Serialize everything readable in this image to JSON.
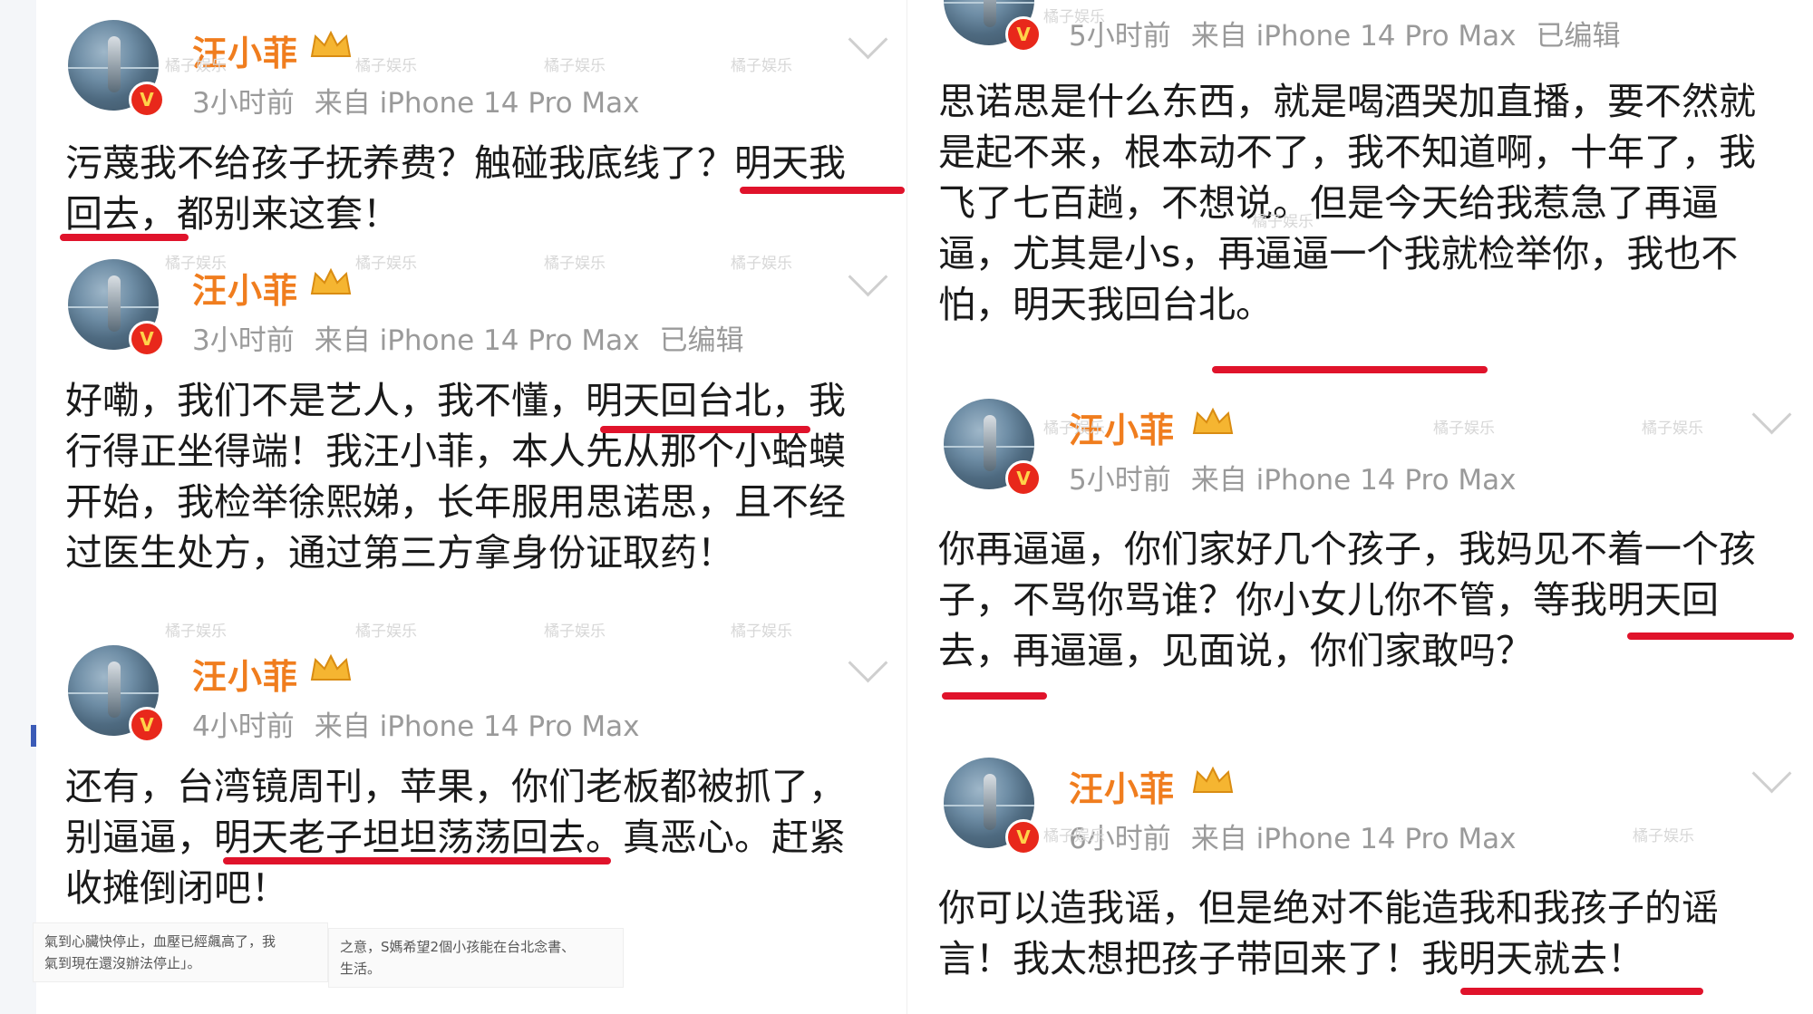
{
  "watermark": "橘子娱乐",
  "left": {
    "posts": [
      {
        "name": "汪小菲",
        "time": "3小时前",
        "source": "来自 iPhone 14 Pro Max",
        "edited": "",
        "text": "污蔑我不给孩子抚养费？触碰我底线了？明天我回去，都别来这套！"
      },
      {
        "name": "汪小菲",
        "time": "3小时前",
        "source": "来自 iPhone 14 Pro Max",
        "edited": "已编辑",
        "text": "好嘞，我们不是艺人，我不懂，明天回台北，我行得正坐得端！我汪小菲，本人先从那个小蛤蟆开始，我检举徐熙娣，长年服用思诺思，且不经过医生处方，通过第三方拿身份证取药！"
      },
      {
        "name": "汪小菲",
        "time": "4小时前",
        "source": "来自 iPhone 14 Pro Max",
        "edited": "",
        "text": "还有，台湾镜周刊，苹果，你们老板都被抓了，别逼逼，明天老子坦坦荡荡回去。真恶心。赶紧收摊倒闭吧！"
      }
    ],
    "snippet_1": "氣到心臟快停止，血壓已經飆高了，我\n氣到現在還沒辦法停止」。",
    "snippet_2": "之意，S媽希望2個小孩能在台北念書、\n生活。"
  },
  "right": {
    "posts": [
      {
        "name": "",
        "time": "5小时前",
        "source": "来自 iPhone 14 Pro Max",
        "edited": "已编辑",
        "text": "思诺思是什么东西，就是喝酒哭加直播，要不然就是起不来，根本动不了，我不知道啊，十年了，我飞了七百趟，不想说。但是今天给我惹急了再逼逼，尤其是小s，再逼逼一个我就检举你，我也不怕，明天我回台北。"
      },
      {
        "name": "汪小菲",
        "time": "5小时前",
        "source": "来自 iPhone 14 Pro Max",
        "edited": "",
        "text": "你再逼逼，你们家好几个孩子，我妈见不着一个孩子，不骂你骂谁？你小女儿你不管，等我明天回去，再逼逼，见面说，你们家敢吗？"
      },
      {
        "name": "汪小菲",
        "time": "6小时前",
        "source": "来自 iPhone 14 Pro Max",
        "edited": "",
        "text": "你可以造我谣，但是绝对不能造我和我孩子的谣言！我太想把孩子带回来了！我明天就去！"
      }
    ]
  },
  "colors": {
    "name": "#f07d1e",
    "underline": "#e0132b",
    "meta": "#9a9a9a",
    "verified": "#e8281b"
  }
}
